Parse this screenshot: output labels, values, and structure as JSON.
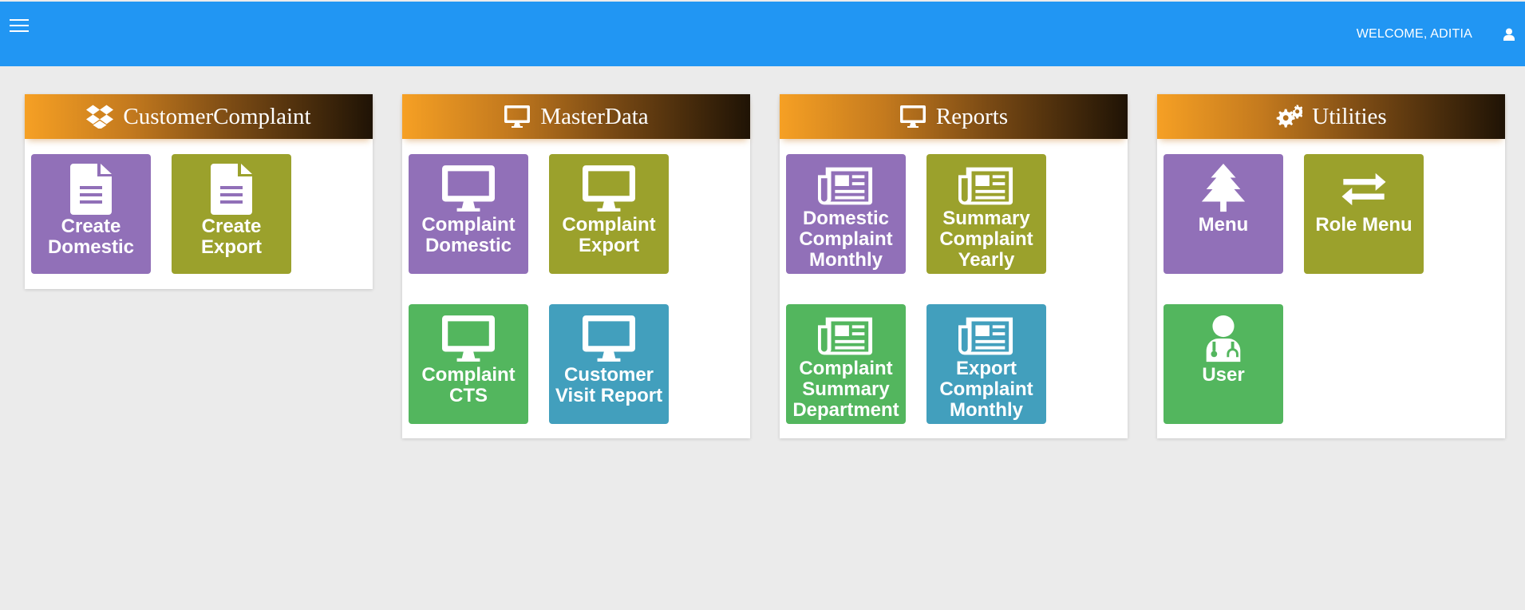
{
  "header": {
    "welcome_text": "WELCOME, ADITIA",
    "menu_icon": "hamburger-icon",
    "user_icon": "user-icon",
    "color": "#2196f3"
  },
  "panels": [
    {
      "title": "CustomerComplaint",
      "icon": "dropbox-icon",
      "tiles": [
        {
          "label": "Create Domestic",
          "icon": "file-icon",
          "color": "#9170b8"
        },
        {
          "label": "Create Export",
          "icon": "file-icon",
          "color": "#9ba12c"
        }
      ]
    },
    {
      "title": "MasterData",
      "icon": "monitor-icon",
      "tiles": [
        {
          "label": "Complaint Domestic",
          "icon": "monitor-icon",
          "color": "#9170b8"
        },
        {
          "label": "Complaint Export",
          "icon": "monitor-icon",
          "color": "#9ba12c"
        },
        {
          "label": "Complaint CTS",
          "icon": "monitor-icon",
          "color": "#53b65e"
        },
        {
          "label": "Customer Visit Report",
          "icon": "monitor-icon",
          "color": "#429fbd"
        }
      ]
    },
    {
      "title": "Reports",
      "icon": "monitor-icon",
      "tiles": [
        {
          "label": "Domestic Complaint Monthly",
          "icon": "newspaper-icon",
          "color": "#9170b8"
        },
        {
          "label": "Summary Complaint Yearly",
          "icon": "newspaper-icon",
          "color": "#9ba12c"
        },
        {
          "label": "Complaint Summary Department",
          "icon": "newspaper-icon",
          "color": "#53b65e"
        },
        {
          "label": "Export Complaint Monthly",
          "icon": "newspaper-icon",
          "color": "#429fbd"
        }
      ]
    },
    {
      "title": "Utilities",
      "icon": "gears-icon",
      "tiles": [
        {
          "label": "Menu",
          "icon": "tree-icon",
          "color": "#9170b8"
        },
        {
          "label": "Role Menu",
          "icon": "exchange-icon",
          "color": "#9ba12c"
        },
        {
          "label": "User",
          "icon": "user-doctor-icon",
          "color": "#53b65e"
        }
      ]
    }
  ]
}
